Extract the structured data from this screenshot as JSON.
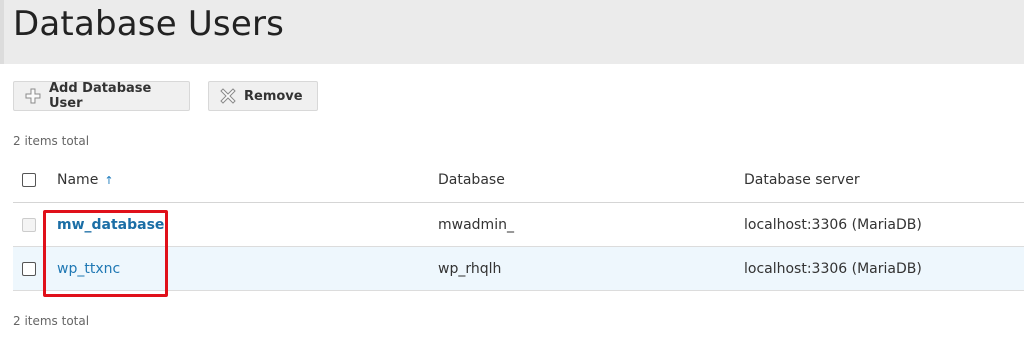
{
  "page": {
    "title": "Database Users"
  },
  "toolbar": {
    "add_label": "Add Database User",
    "add_icon": "plus-icon",
    "remove_label": "Remove",
    "remove_icon": "cross-icon"
  },
  "list": {
    "count_top": "2 items total",
    "count_bottom": "2 items total",
    "columns": {
      "name": "Name",
      "name_sort": "↑",
      "database": "Database",
      "server": "Database server"
    },
    "rows": [
      {
        "name": "mw_database",
        "database": "mwadmin_",
        "server": "localhost:3306 (MariaDB)",
        "checkbox_disabled": true
      },
      {
        "name": "wp_ttxnc",
        "database": "wp_rhqlh",
        "server": "localhost:3306 (MariaDB)",
        "checkbox_disabled": false
      }
    ]
  },
  "colors": {
    "link": "#1f78b4",
    "selected_row": "#eef7fd",
    "highlight": "#e0101a",
    "header_bg": "#ebebeb"
  }
}
